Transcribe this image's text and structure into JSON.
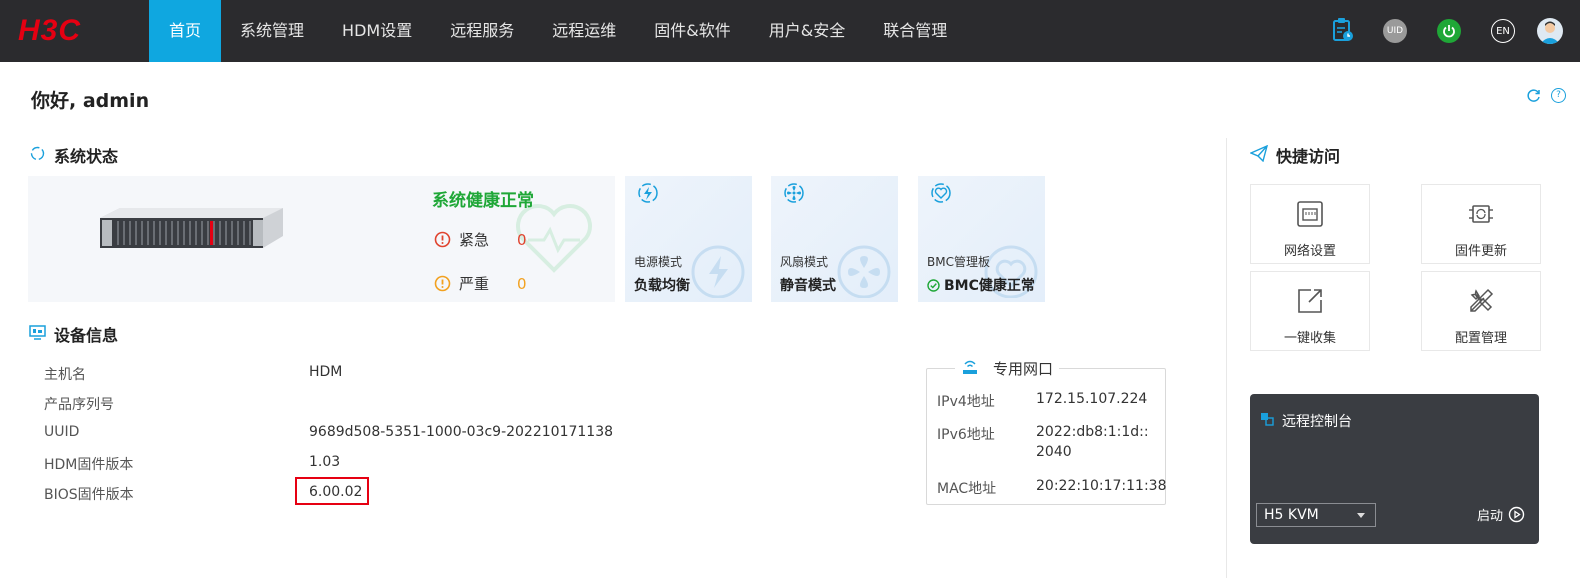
{
  "brand": {
    "logo_text": "H3C"
  },
  "nav": {
    "items": [
      {
        "label": "首页",
        "active": true
      },
      {
        "label": "系统管理"
      },
      {
        "label": "HDM设置"
      },
      {
        "label": "远程服务"
      },
      {
        "label": "远程运维"
      },
      {
        "label": "固件&软件"
      },
      {
        "label": "用户&安全"
      },
      {
        "label": "联合管理"
      }
    ],
    "icons": {
      "uid": "UID",
      "lang": "EN"
    }
  },
  "greeting": "你好, admin",
  "system_status": {
    "title": "系统状态",
    "health_text": "系统健康正常",
    "urgent_label": "紧急",
    "urgent_count": "0",
    "severe_label": "严重",
    "severe_count": "0",
    "power": {
      "label": "电源模式",
      "value": "负载均衡"
    },
    "fan": {
      "label": "风扇模式",
      "value": "静音模式"
    },
    "bmc": {
      "label": "BMC管理板",
      "value": "BMC健康正常"
    }
  },
  "device_info": {
    "title": "设备信息",
    "rows": [
      {
        "label": "主机名",
        "value": "HDM"
      },
      {
        "label": "产品序列号",
        "value": ""
      },
      {
        "label": "UUID",
        "value": "9689d508-5351-1000-03c9-202210171138"
      },
      {
        "label": "HDM固件版本",
        "value": "1.03"
      },
      {
        "label": "BIOS固件版本",
        "value": "6.00.02"
      }
    ]
  },
  "dedicated_port": {
    "title": "专用网口",
    "ipv4_label": "IPv4地址",
    "ipv4": "172.15.107.224",
    "ipv6_label": "IPv6地址",
    "ipv6": "2022:db8:1:1d::2040",
    "mac_label": "MAC地址",
    "mac": "20:22:10:17:11:38"
  },
  "quick_access": {
    "title": "快捷访问",
    "items": [
      {
        "label": "网络设置",
        "icon": "network-icon"
      },
      {
        "label": "固件更新",
        "icon": "chip-icon"
      },
      {
        "label": "一键收集",
        "icon": "export-icon"
      },
      {
        "label": "配置管理",
        "icon": "tools-icon"
      }
    ]
  },
  "remote_console": {
    "title": "远程控制台",
    "selected": "H5 KVM",
    "launch_label": "启动"
  },
  "colors": {
    "accent": "#0fa7e0",
    "topbar": "#2b2b2e",
    "health_green": "#1fa737",
    "urgent_red": "#e0442f",
    "severe_orange": "#f2a11f"
  }
}
